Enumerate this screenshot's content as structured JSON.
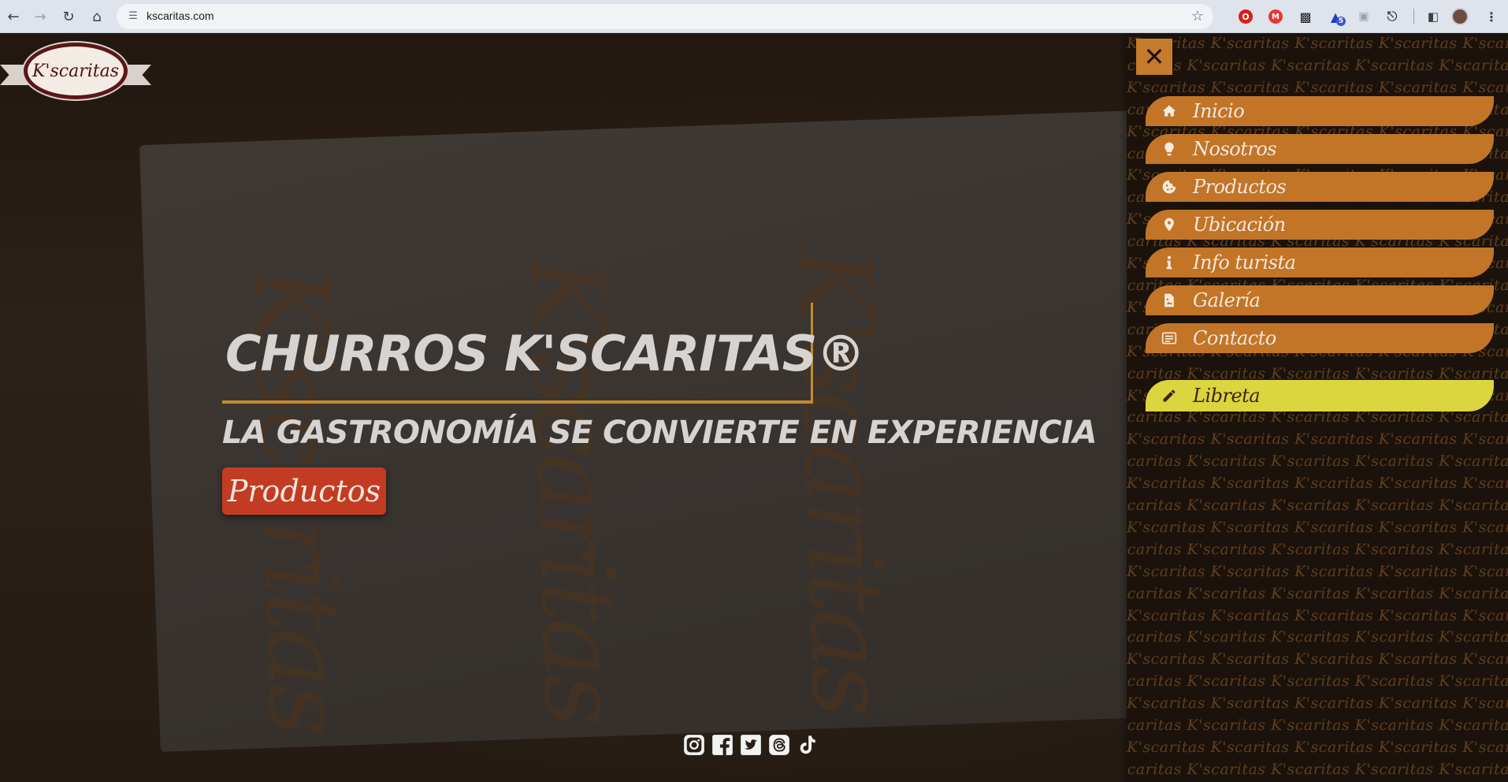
{
  "browser": {
    "url": "kscaritas.com",
    "back_icon": "arrow-left-icon",
    "forward_icon": "arrow-right-icon",
    "reload_icon": "reload-icon",
    "home_icon": "home-icon",
    "bookmark_icon": "star-icon",
    "extensions": [
      "opera-extension-icon",
      "m-extension-icon",
      "clapper-extension-icon",
      "badge-extension-icon",
      "cast-extension-icon",
      "puzzle-extension-icon",
      "side-panel-icon",
      "profile-avatar-icon",
      "kebab-menu-icon"
    ],
    "extension_badge": "5"
  },
  "logo": {
    "text": "K'scaritas"
  },
  "hero": {
    "title": "CHURROS K'SCARITAS®",
    "subtitle": "LA GASTRONOMÍA SE CONVIERTE EN EXPERIENCIA",
    "button_label": "Productos"
  },
  "social": [
    "instagram-icon",
    "facebook-icon",
    "twitter-icon",
    "threads-icon",
    "tiktok-icon"
  ],
  "menu": {
    "close_label": "✕",
    "items": [
      {
        "label": "Inicio",
        "icon": "home-icon"
      },
      {
        "label": "Nosotros",
        "icon": "lightbulb-icon"
      },
      {
        "label": "Productos",
        "icon": "cookie-icon"
      },
      {
        "label": "Ubicación",
        "icon": "map-pin-icon"
      },
      {
        "label": "Info turista",
        "icon": "info-icon"
      },
      {
        "label": "Galería",
        "icon": "file-image-icon"
      },
      {
        "label": "Contacto",
        "icon": "contact-card-icon"
      }
    ],
    "special": {
      "label": "Libreta",
      "icon": "pencil-icon"
    }
  },
  "pattern_text": "K'scaritas",
  "colors": {
    "menu_item": "#c27427",
    "menu_highlight": "#dbd53f",
    "cta": "#c33b23",
    "hero_border": "#c48a2e"
  }
}
